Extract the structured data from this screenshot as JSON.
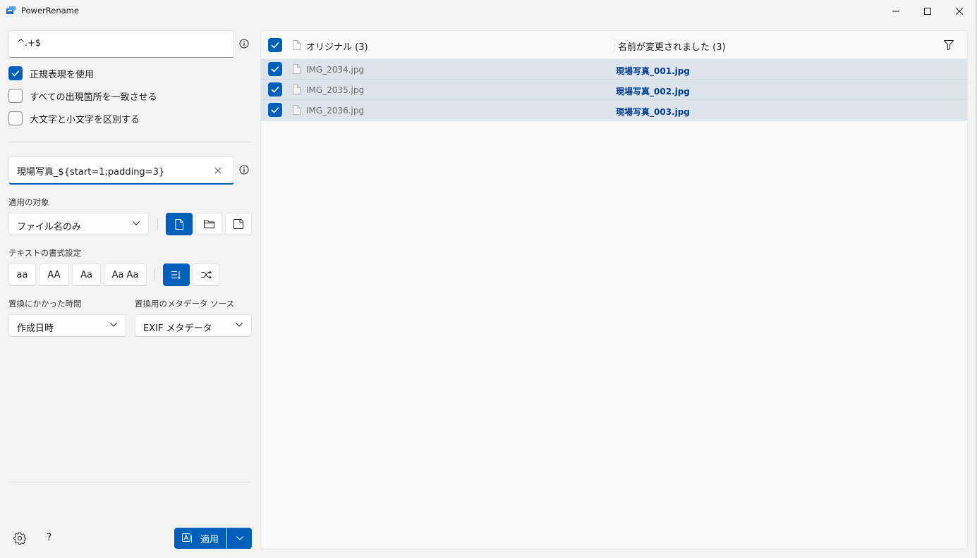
{
  "app": {
    "title": "PowerRename"
  },
  "search": {
    "value": "^.+$"
  },
  "options": {
    "use_regex": {
      "label": "正規表現を使用",
      "checked": true
    },
    "match_all": {
      "label": "すべての出現箇所を一致させる",
      "checked": false
    },
    "case_sensitive": {
      "label": "大文字と小文字を区別する",
      "checked": false
    }
  },
  "replace": {
    "value": "現場写真_${start=1;padding=3}"
  },
  "apply_to": {
    "label": "適用の対象",
    "selected": "ファイル名のみ"
  },
  "text_format": {
    "label": "テキストの書式設定",
    "lowercase": "aa",
    "uppercase": "AA",
    "titlecase": "Aa",
    "capitalize": "Aa Aa"
  },
  "time_source": {
    "label": "置換にかかった時間",
    "selected": "作成日時"
  },
  "metadata_source": {
    "label": "置換用のメタデータ ソース",
    "selected": "EXIF メタデータ"
  },
  "apply_button": {
    "label": "適用"
  },
  "help_label": "?",
  "table": {
    "original_header": "オリジナル (3)",
    "renamed_header": "名前が変更されました (3)",
    "rows": [
      {
        "original": "IMG_2034.jpg",
        "renamed": "現場写真_001.jpg",
        "checked": true
      },
      {
        "original": "IMG_2035.jpg",
        "renamed": "現場写真_002.jpg",
        "checked": true
      },
      {
        "original": "IMG_2036.jpg",
        "renamed": "現場写真_003.jpg",
        "checked": true
      }
    ]
  },
  "colors": {
    "accent": "#005fb8",
    "row_highlight": "#dde4ec",
    "renamed_text": "#003e92"
  }
}
